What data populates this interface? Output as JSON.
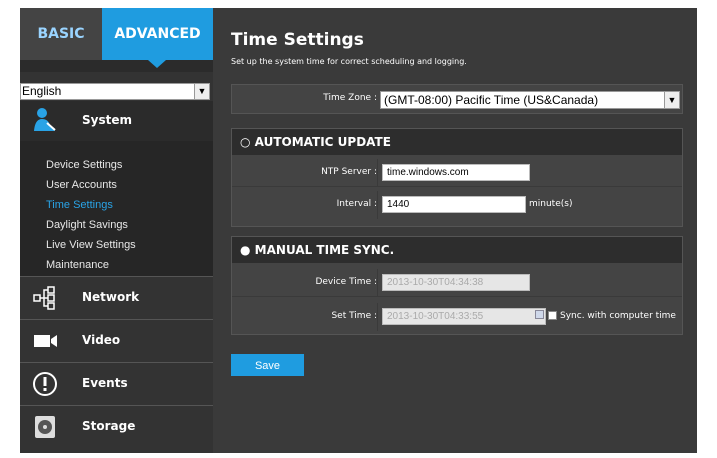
{
  "tabs": {
    "basic": "BASIC",
    "advanced": "ADVANCED"
  },
  "language": {
    "selected": "English"
  },
  "sidebar": {
    "system_label": "System",
    "submenu": [
      {
        "label": "Device Settings",
        "active": false
      },
      {
        "label": "User Accounts",
        "active": false
      },
      {
        "label": "Time Settings",
        "active": true
      },
      {
        "label": "Daylight Savings",
        "active": false
      },
      {
        "label": "Live View Settings",
        "active": false
      },
      {
        "label": "Maintenance",
        "active": false
      }
    ],
    "sections": [
      {
        "label": "Network",
        "icon": "network-icon"
      },
      {
        "label": "Video",
        "icon": "video-camera-icon"
      },
      {
        "label": "Events",
        "icon": "alert-icon"
      },
      {
        "label": "Storage",
        "icon": "storage-disk-icon"
      }
    ]
  },
  "main": {
    "title": "Time Settings",
    "subtitle": "Set up the system time for correct scheduling and logging.",
    "time_zone": {
      "label": "Time Zone :",
      "value": "(GMT-08:00) Pacific Time (US&Canada)"
    },
    "automatic_update": {
      "heading": "AUTOMATIC UPDATE",
      "ntp_label": "NTP Server :",
      "ntp_value": "time.windows.com",
      "interval_label": "Interval :",
      "interval_value": "1440",
      "interval_unit": "minute(s)"
    },
    "manual_sync": {
      "heading": "MANUAL TIME SYNC.",
      "device_time_label": "Device Time :",
      "device_time_value": "2013-10-30T04:34:38",
      "set_time_label": "Set Time :",
      "set_time_value": "2013-10-30T04:33:55",
      "sync_label": "Sync. with computer time"
    },
    "save_label": "Save"
  },
  "colors": {
    "accent": "#1f9ce0",
    "background": "#3a3a3a",
    "active_link": "#29a3e6"
  }
}
